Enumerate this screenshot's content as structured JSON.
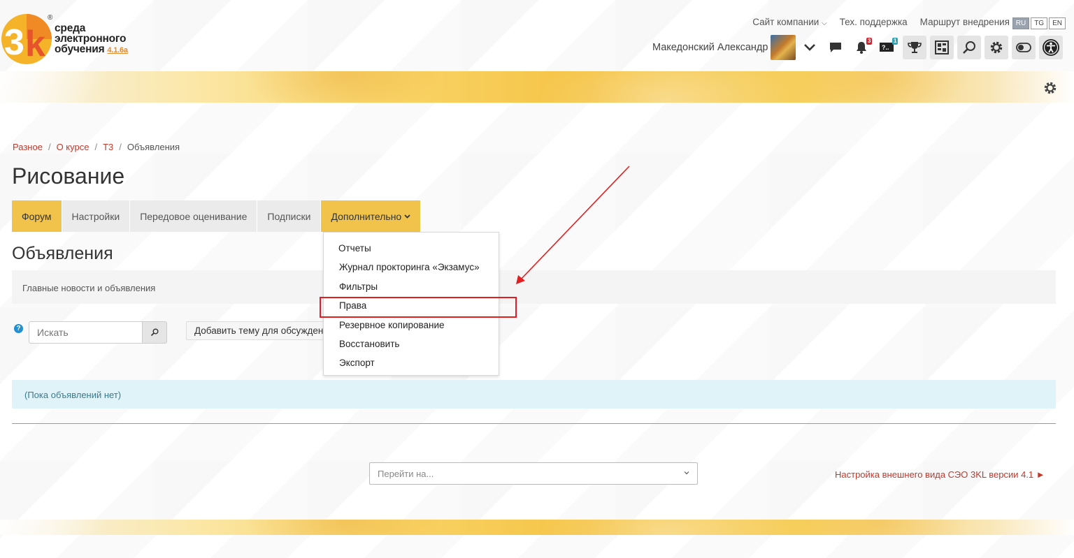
{
  "brand": {
    "logo_mark": "3k",
    "line1": "среда",
    "line2": "электронного",
    "line3": "обучения",
    "version": "4.1.6a",
    "accent_color": "#f2c34a"
  },
  "topnav": {
    "company_site": "Сайт компании",
    "support": "Тех. поддержка",
    "route": "Маршрут внедрения",
    "langs": [
      "RU",
      "TG",
      "EN"
    ]
  },
  "user": {
    "name": "Македонский Александр",
    "notifications_count": "3",
    "questions_count": "1"
  },
  "breadcrumb": [
    "Разное",
    "О курсе",
    "Т3",
    "Объявления"
  ],
  "page_title": "Рисование",
  "tabs": {
    "forum": "Форум",
    "settings": "Настройки",
    "advanced_grading": "Передовое оценивание",
    "subscriptions": "Подписки",
    "more": "Дополнительно"
  },
  "dropdown": {
    "items": [
      "Отчеты",
      "Журнал прокторинга «Экзамус»",
      "Фильтры",
      "Права",
      "Резервное копирование",
      "Восстановить",
      "Экспорт"
    ]
  },
  "section_title": "Объявления",
  "intro": "Главные новости и объявления",
  "search": {
    "placeholder": "Искать"
  },
  "add_topic": "Добавить тему для обсуждения",
  "notice": "(Пока объявлений нет)",
  "jump": {
    "placeholder": "Перейти на..."
  },
  "next_link": "Настройка внешнего вида СЭО 3KL версии 4.1 ►"
}
